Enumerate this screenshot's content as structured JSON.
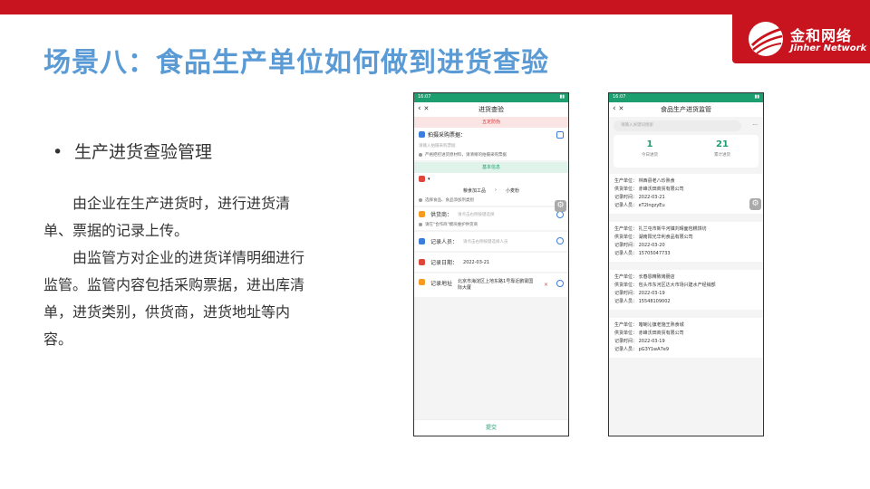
{
  "brand": {
    "name_cn": "金和网络",
    "name_en": "Jinher Network"
  },
  "title": "场景八：食品生产单位如何做到进货查验",
  "bullet": "生产进货查验管理",
  "paragraphs": [
    "由企业在生产进货时，进行进货清单、票据的记录上传。",
    "由监管方对企业的进货详情明细进行监管。监管内容包括采购票据，进出库清单，进货类别，供货商，进货地址等内容。"
  ],
  "phone_left": {
    "status_time": "16:07",
    "title": "进货查验",
    "section_red": "五定防伪",
    "receipt_label": "拍摄采购票据：",
    "receipt_placeholder": "请输入拍摄采购票据",
    "receipt_note": "严格把控进货原材料，请清晰的拍摄采购票据",
    "section_green": "基本信息",
    "category_a": "粮食加工品",
    "category_b": "小麦粉",
    "category_note": "选择食品、食品添加剂类别",
    "supplier_label": "供货商：",
    "supplier_placeholder": "请点击右侧按键选择",
    "supplier_note": "请在\"合作商\"模块维护供货商",
    "recorder_label": "记录人员：",
    "recorder_placeholder": "请点击右侧按键选择人员",
    "date_label": "记录日期：",
    "date_value": "2022-03-21",
    "address_label": "记录地址",
    "address_value": "北京市海淀区上地东路1号靠近鹏寰国际大厦",
    "submit": "提交"
  },
  "phone_right": {
    "status_time": "16:07",
    "title": "食品生产进货监管",
    "search_placeholder": "请输入关键词搜索",
    "more": "···",
    "stats": [
      {
        "num": "1",
        "label": "今日进货"
      },
      {
        "num": "21",
        "label": "累计进货"
      }
    ],
    "records": [
      {
        "unit": "生产单位： 林西县老八珍熟食",
        "supplier": "供货单位： 赤峰沃田商贸有限公司",
        "time": "记录时间： 2022-03-21",
        "person": "记录人员： eT2IngzyEu"
      },
      {
        "unit": "生产单位： 扎兰屯市新牛河镇刘晴面包糕饼坊",
        "supplier": "供货单位： 湖南阳光华利食品有限公司",
        "time": "记录时间： 2022-03-20",
        "person": "记录人员： 15705047733"
      },
      {
        "unit": "生产单位： 长春恩精致烤肠店",
        "supplier": "供货单位： 包头市东河区达大市场兴建水产经销部",
        "time": "记录时间： 2022-03-19",
        "person": "记录人员： 15548109002"
      },
      {
        "unit": "生产单位： 喀喇沁旗老施王熟食城",
        "supplier": "供货单位： 赤峰沃田商贸有限公司",
        "time": "记录时间： 2022-03-19",
        "person": "记录人员： pG3Y1wA7e9"
      }
    ]
  },
  "colors": {
    "brand_red": "#c8141e",
    "title_blue": "#5b9bd5",
    "app_green": "#1d9e6e"
  },
  "icons": {
    "back": "‹",
    "close": "✕",
    "gear": "⚙",
    "delete": "×"
  }
}
